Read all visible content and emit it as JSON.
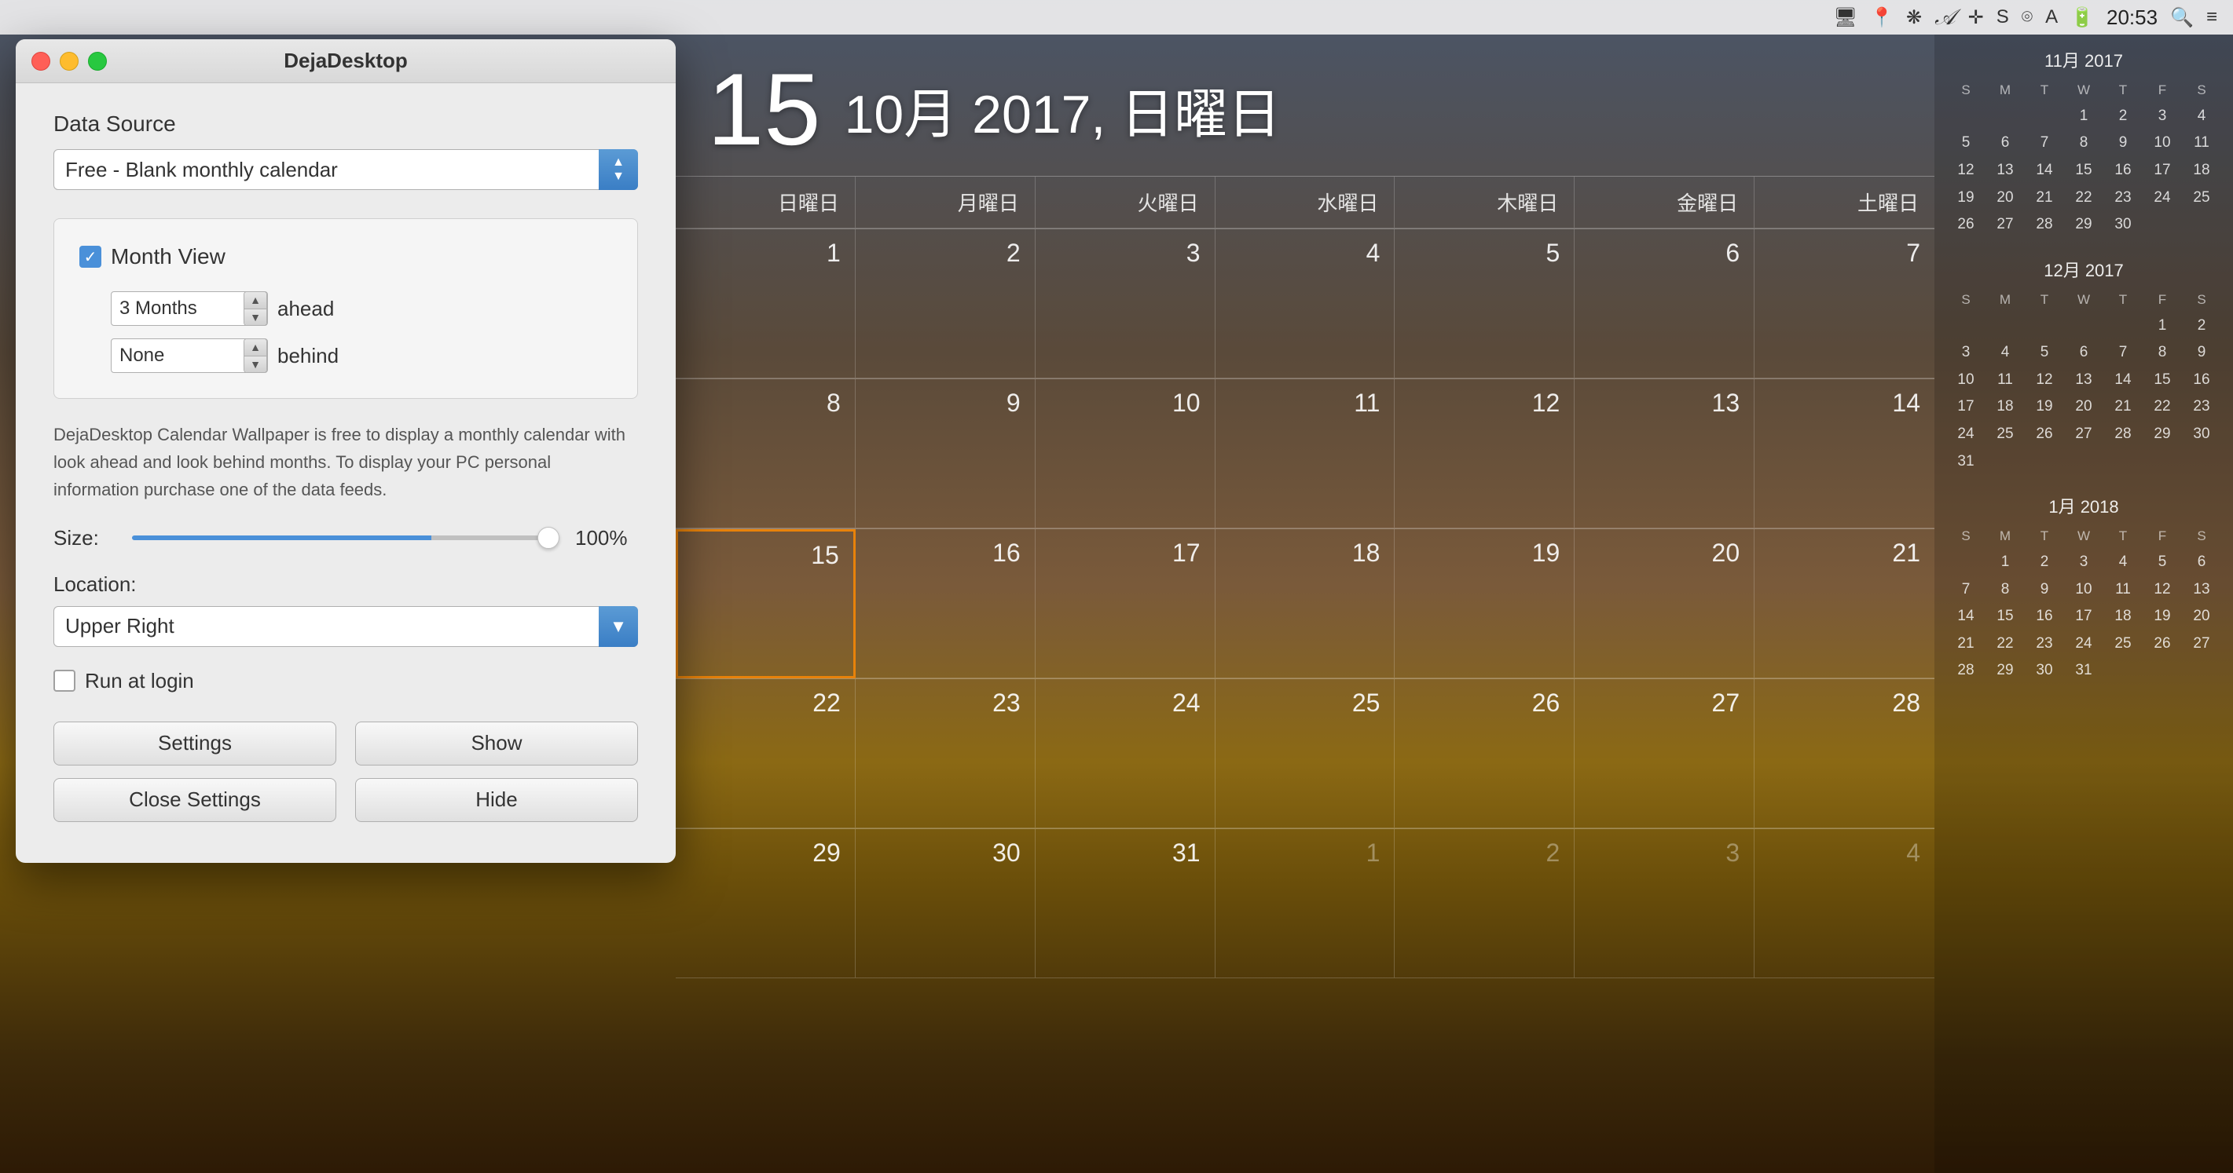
{
  "menubar": {
    "time": "20:53",
    "icons": [
      "monitor-icon",
      "location-icon",
      "dropbox-icon",
      "signature-icon",
      "crosshair-icon",
      "s-icon",
      "wifi-icon",
      "a-icon",
      "battery-icon",
      "search-icon",
      "menu-icon"
    ]
  },
  "window": {
    "title": "DejaDesktop",
    "traffic_lights": [
      "close",
      "minimize",
      "maximize"
    ]
  },
  "settings": {
    "data_source_label": "Data Source",
    "data_source_value": "Free - Blank monthly calendar",
    "month_view_label": "Month View",
    "month_view_checked": true,
    "ahead_value": "3 Months",
    "ahead_label": "ahead",
    "behind_value": "None",
    "behind_label": "behind",
    "info_text": "DejaDesktop Calendar Wallpaper is free to display a monthly calendar with look ahead and look behind months. To display your PC personal information purchase one of the data feeds.",
    "size_label": "Size:",
    "size_value": "100%",
    "size_percent": 70,
    "location_label": "Location:",
    "location_value": "Upper Right",
    "run_at_login_label": "Run at login",
    "run_at_login_checked": false,
    "btn_settings": "Settings",
    "btn_show": "Show",
    "btn_close_settings": "Close Settings",
    "btn_hide": "Hide"
  },
  "calendar": {
    "day_number": "15",
    "date_text": "10月 2017, 日曜日",
    "headers": [
      "日曜日",
      "月曜日",
      "火曜日",
      "水曜日",
      "木曜日",
      "金曜日",
      "土曜日"
    ],
    "weeks": [
      [
        {
          "day": "1",
          "other": false
        },
        {
          "day": "2",
          "other": false
        },
        {
          "day": "3",
          "other": false
        },
        {
          "day": "4",
          "other": false
        },
        {
          "day": "5",
          "other": false
        },
        {
          "day": "6",
          "other": false
        },
        {
          "day": "7",
          "other": false
        }
      ],
      [
        {
          "day": "8",
          "other": false
        },
        {
          "day": "9",
          "other": false
        },
        {
          "day": "10",
          "other": false
        },
        {
          "day": "11",
          "other": false
        },
        {
          "day": "12",
          "other": false
        },
        {
          "day": "13",
          "other": false
        },
        {
          "day": "14",
          "other": false
        }
      ],
      [
        {
          "day": "15",
          "today": true,
          "other": false
        },
        {
          "day": "16",
          "other": false
        },
        {
          "day": "17",
          "other": false
        },
        {
          "day": "18",
          "other": false
        },
        {
          "day": "19",
          "other": false
        },
        {
          "day": "20",
          "other": false
        },
        {
          "day": "21",
          "other": false
        }
      ],
      [
        {
          "day": "22",
          "other": false
        },
        {
          "day": "23",
          "other": false
        },
        {
          "day": "24",
          "other": false
        },
        {
          "day": "25",
          "other": false
        },
        {
          "day": "26",
          "other": false
        },
        {
          "day": "27",
          "other": false
        },
        {
          "day": "28",
          "other": false
        }
      ],
      [
        {
          "day": "29",
          "other": false
        },
        {
          "day": "30",
          "other": false
        },
        {
          "day": "31",
          "other": false
        },
        {
          "day": "1",
          "other": true
        },
        {
          "day": "2",
          "other": true
        },
        {
          "day": "3",
          "other": true
        },
        {
          "day": "4",
          "other": true
        }
      ]
    ]
  },
  "mini_calendars": [
    {
      "title": "11月 2017",
      "headers": [
        "S",
        "M",
        "T",
        "W",
        "T",
        "F",
        "S"
      ],
      "weeks": [
        [
          "",
          "",
          "",
          "1",
          "2",
          "3",
          "4"
        ],
        [
          "5",
          "6",
          "7",
          "8",
          "9",
          "10",
          "11"
        ],
        [
          "12",
          "13",
          "14",
          "15",
          "16",
          "17",
          "18"
        ],
        [
          "19",
          "20",
          "21",
          "22",
          "23",
          "24",
          "25"
        ],
        [
          "26",
          "27",
          "28",
          "29",
          "30",
          "",
          ""
        ]
      ]
    },
    {
      "title": "12月 2017",
      "headers": [
        "S",
        "M",
        "T",
        "W",
        "T",
        "F",
        "S"
      ],
      "weeks": [
        [
          "",
          "",
          "",
          "",
          "",
          "1",
          "2"
        ],
        [
          "3",
          "4",
          "5",
          "6",
          "7",
          "8",
          "9"
        ],
        [
          "10",
          "11",
          "12",
          "13",
          "14",
          "15",
          "16"
        ],
        [
          "17",
          "18",
          "19",
          "20",
          "21",
          "22",
          "23"
        ],
        [
          "24",
          "25",
          "26",
          "27",
          "28",
          "29",
          "30"
        ],
        [
          "31",
          "",
          "",
          "",
          "",
          "",
          ""
        ]
      ]
    },
    {
      "title": "1月 2018",
      "headers": [
        "S",
        "M",
        "T",
        "W",
        "T",
        "F",
        "S"
      ],
      "weeks": [
        [
          "",
          "1",
          "2",
          "3",
          "4",
          "5",
          "6"
        ],
        [
          "7",
          "8",
          "9",
          "10",
          "11",
          "12",
          "13"
        ],
        [
          "14",
          "15",
          "16",
          "17",
          "18",
          "19",
          "20"
        ],
        [
          "21",
          "22",
          "23",
          "24",
          "25",
          "26",
          "27"
        ],
        [
          "28",
          "29",
          "30",
          "31",
          "",
          "",
          ""
        ]
      ]
    }
  ]
}
